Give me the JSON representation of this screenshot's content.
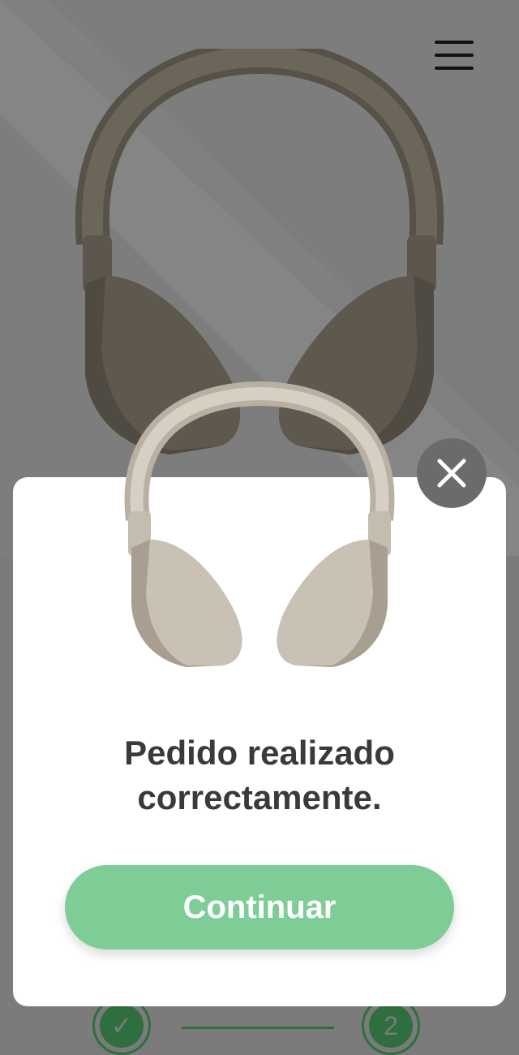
{
  "header": {
    "menu_icon": "hamburger-menu-icon"
  },
  "modal": {
    "close_icon": "close-icon",
    "image": "headphones-beige",
    "message_line1": "Pedido realizado",
    "message_line2": "correctamente.",
    "continue_label": "Continuar"
  },
  "background": {
    "image": "headphones-dark"
  },
  "stepper": {
    "step1_icon": "check-icon",
    "step2_label": "2"
  },
  "colors": {
    "accent": "#7ecd97",
    "modal_bg": "#ffffff",
    "overlay": "#7d7d7d",
    "stepper": "#2f6f3f"
  }
}
